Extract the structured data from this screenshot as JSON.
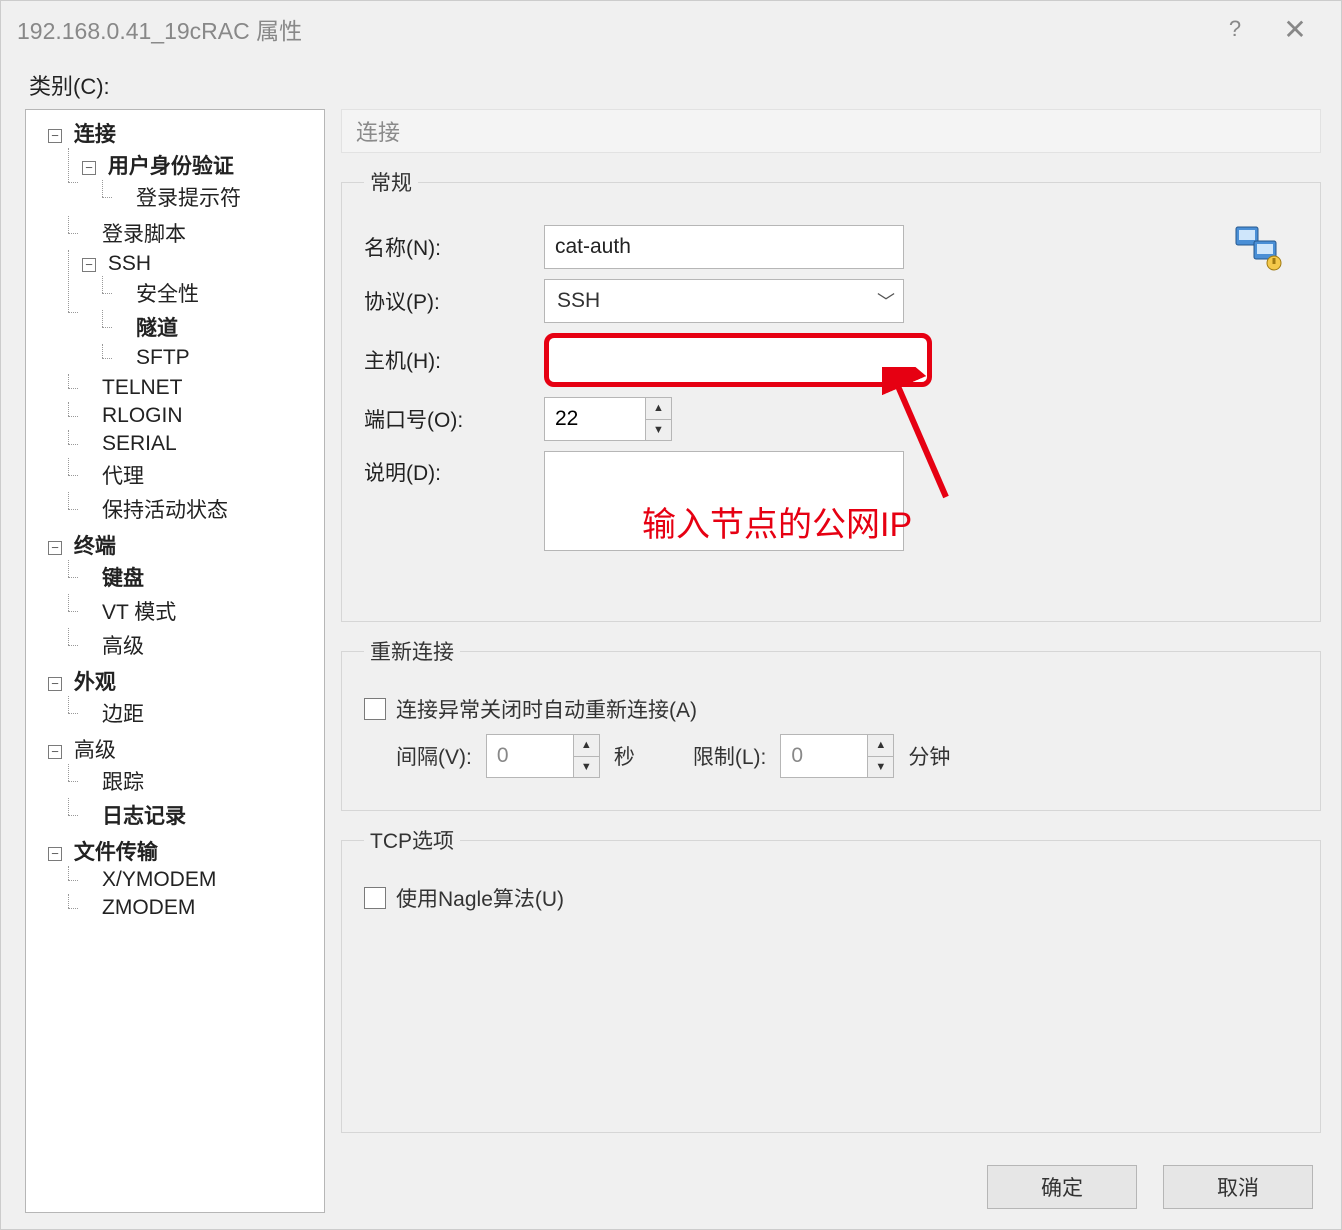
{
  "window": {
    "title": "192.168.0.41_19cRAC 属性",
    "help": "?",
    "close": "✕"
  },
  "category_label": "类别(C):",
  "tree": {
    "connection": "连接",
    "user_auth": "用户身份验证",
    "login_prompt": "登录提示符",
    "login_script": "登录脚本",
    "ssh": "SSH",
    "security": "安全性",
    "tunnel": "隧道",
    "sftp": "SFTP",
    "telnet": "TELNET",
    "rlogin": "RLOGIN",
    "serial": "SERIAL",
    "proxy": "代理",
    "keepalive": "保持活动状态",
    "terminal": "终端",
    "keyboard": "键盘",
    "vt_mode": "VT 模式",
    "advanced_term": "高级",
    "appearance": "外观",
    "margin": "边距",
    "advanced": "高级",
    "trace": "跟踪",
    "logging": "日志记录",
    "file_transfer": "文件传输",
    "xymodem": "X/YMODEM",
    "zmodem": "ZMODEM"
  },
  "page": {
    "title": "连接"
  },
  "general": {
    "legend": "常规",
    "name_label": "名称(N):",
    "name_value": "cat-auth",
    "protocol_label": "协议(P):",
    "protocol_value": "SSH",
    "host_label": "主机(H):",
    "host_value": "",
    "port_label": "端口号(O):",
    "port_value": "22",
    "desc_label": "说明(D):"
  },
  "annotation": "输入节点的公网IP",
  "reconnect": {
    "legend": "重新连接",
    "auto_label": "连接异常关闭时自动重新连接(A)",
    "interval_label": "间隔(V):",
    "interval_value": "0",
    "interval_unit": "秒",
    "limit_label": "限制(L):",
    "limit_value": "0",
    "limit_unit": "分钟"
  },
  "tcp": {
    "legend": "TCP选项",
    "nagle_label": "使用Nagle算法(U)"
  },
  "buttons": {
    "ok": "确定",
    "cancel": "取消"
  }
}
